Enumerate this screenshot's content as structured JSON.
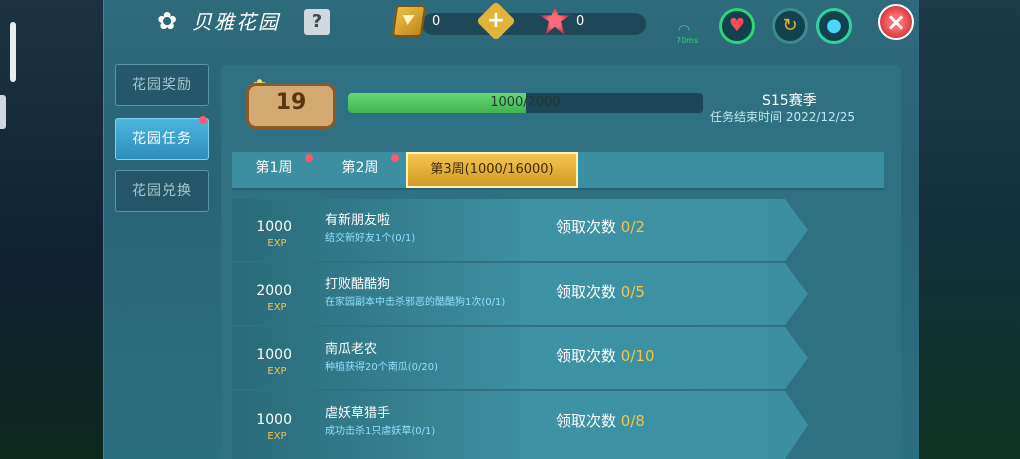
{
  "header": {
    "title": "贝雅花园",
    "help": "?",
    "gem_value": "0",
    "token_value": "0",
    "ping": "70ms"
  },
  "sidebar": {
    "items": [
      {
        "label": "花园奖励"
      },
      {
        "label": "花园任务"
      },
      {
        "label": "花园兑换"
      }
    ]
  },
  "level": {
    "value": "19",
    "progress_text": "1000/2000",
    "progress_fraction": 0.5
  },
  "season": {
    "name": "S15赛季",
    "end_text": "任务结束时间 2022/12/25"
  },
  "tabs": [
    {
      "label": "第1周"
    },
    {
      "label": "第2周"
    },
    {
      "label": "第3周(1000/16000)"
    }
  ],
  "tasks": [
    {
      "exp": "1000",
      "exp_label": "EXP",
      "name": "有新朋友啦",
      "desc": "结交新好友1个(0/1)",
      "claim_label": "领取次数",
      "claim_value": "0/2"
    },
    {
      "exp": "2000",
      "exp_label": "EXP",
      "name": "打败酷酷狗",
      "desc": "在家园副本中击杀邪恶的酷酷狗1次(0/1)",
      "claim_label": "领取次数",
      "claim_value": "0/5"
    },
    {
      "exp": "1000",
      "exp_label": "EXP",
      "name": "南瓜老农",
      "desc": "种植获得20个南瓜(0/20)",
      "claim_label": "领取次数",
      "claim_value": "0/10"
    },
    {
      "exp": "1000",
      "exp_label": "EXP",
      "name": "虐妖草猎手",
      "desc": "成功击杀1只虐妖草(0/1)",
      "claim_label": "领取次数",
      "claim_value": "0/8"
    }
  ]
}
